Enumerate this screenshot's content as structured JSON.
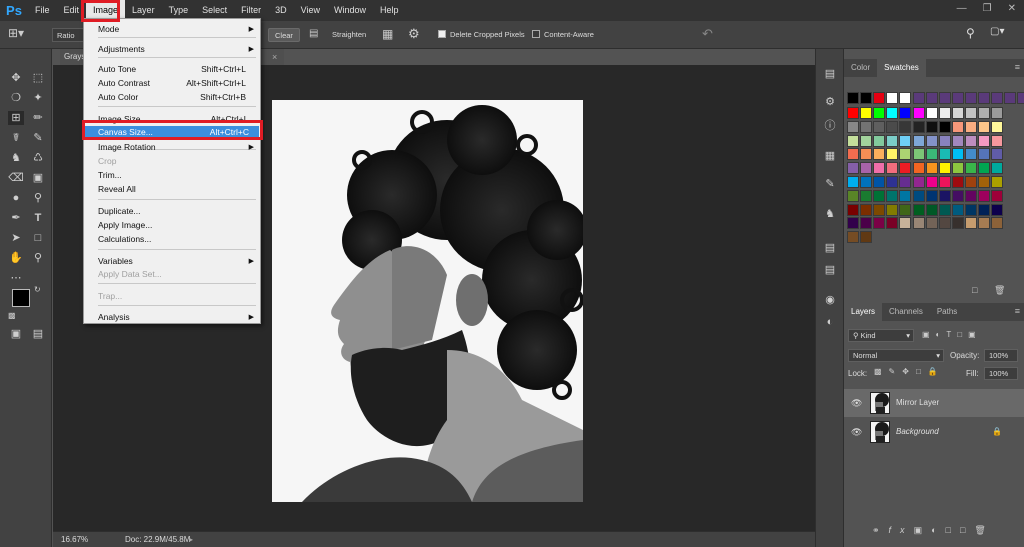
{
  "app": {
    "logo": "Ps"
  },
  "menubar": {
    "items": [
      "File",
      "Edit",
      "Image",
      "Layer",
      "Type",
      "Select",
      "Filter",
      "3D",
      "View",
      "Window",
      "Help"
    ],
    "active": "Image"
  },
  "options_bar": {
    "ratio_label": "Ratio",
    "clear_label": "Clear",
    "straighten_label": "Straighten",
    "delete_cropped_label": "Delete Cropped Pixels",
    "content_aware_label": "Content-Aware"
  },
  "document": {
    "tab_label": "Grays"
  },
  "status": {
    "zoom": "16.67%",
    "doc_size": "Doc: 22.9M/45.8M"
  },
  "image_menu": {
    "items": [
      {
        "label": "Mode",
        "shortcut": "",
        "submenu": true,
        "disabled": false
      },
      {
        "label": "Adjustments",
        "shortcut": "",
        "submenu": true,
        "disabled": false
      },
      {
        "label": "Auto Tone",
        "shortcut": "Shift+Ctrl+L",
        "submenu": false,
        "disabled": false
      },
      {
        "label": "Auto Contrast",
        "shortcut": "Alt+Shift+Ctrl+L",
        "submenu": false,
        "disabled": false
      },
      {
        "label": "Auto Color",
        "shortcut": "Shift+Ctrl+B",
        "submenu": false,
        "disabled": false
      },
      {
        "label": "Image Size...",
        "shortcut": "Alt+Ctrl+I",
        "submenu": false,
        "disabled": false
      },
      {
        "label": "Canvas Size...",
        "shortcut": "Alt+Ctrl+C",
        "submenu": false,
        "disabled": false,
        "highlighted": true
      },
      {
        "label": "Image Rotation",
        "shortcut": "",
        "submenu": true,
        "disabled": false
      },
      {
        "label": "Crop",
        "shortcut": "",
        "submenu": false,
        "disabled": true
      },
      {
        "label": "Trim...",
        "shortcut": "",
        "submenu": false,
        "disabled": false
      },
      {
        "label": "Reveal All",
        "shortcut": "",
        "submenu": false,
        "disabled": false
      },
      {
        "label": "Duplicate...",
        "shortcut": "",
        "submenu": false,
        "disabled": false
      },
      {
        "label": "Apply Image...",
        "shortcut": "",
        "submenu": false,
        "disabled": false
      },
      {
        "label": "Calculations...",
        "shortcut": "",
        "submenu": false,
        "disabled": false
      },
      {
        "label": "Variables",
        "shortcut": "",
        "submenu": true,
        "disabled": false
      },
      {
        "label": "Apply Data Set...",
        "shortcut": "",
        "submenu": false,
        "disabled": true
      },
      {
        "label": "Trap...",
        "shortcut": "",
        "submenu": false,
        "disabled": true
      },
      {
        "label": "Analysis",
        "shortcut": "",
        "submenu": true,
        "disabled": false
      }
    ]
  },
  "color_panel": {
    "tabs": [
      "Color",
      "Swatches"
    ],
    "active": "Swatches"
  },
  "swatches": {
    "row0": [
      "#000000",
      "#000000",
      "#e60012",
      "#ffffff",
      "#ffffff",
      "#5a3a7a",
      "#5a3a7a",
      "#5a3a7a",
      "#5a3a7a",
      "#5a3a7a",
      "#5a3a7a",
      "#5a3a7a",
      "#5a3a7a",
      "#5a3a7a"
    ],
    "grid": [
      [
        "#ff0000",
        "#ffff00",
        "#00ff00",
        "#00ffff",
        "#0000ff",
        "#ff00ff",
        "#ffffff",
        "#ebebeb",
        "#d7d7d7",
        "#c3c3c3",
        "#afafaf",
        "#9b9b9b"
      ],
      [
        "#878787",
        "#737373",
        "#5f5f5f",
        "#4b4b4b",
        "#373737",
        "#232323",
        "#0f0f0f",
        "#000000",
        "#f7977a",
        "#f9ad81",
        "#fdc68a",
        "#fff79a"
      ],
      [
        "#c4df9b",
        "#a2d39c",
        "#82ca9d",
        "#7bcdc8",
        "#6ecff6",
        "#7ea7d8",
        "#8493ca",
        "#8882be",
        "#a187be",
        "#bc8dbf",
        "#f49ac2",
        "#f6989d"
      ],
      [
        "#f26c4f",
        "#f68e55",
        "#fbaf5c",
        "#fff467",
        "#acd372",
        "#7cc576",
        "#3bb878",
        "#1abbb4",
        "#00bff3",
        "#438ccb",
        "#5574b9",
        "#605ca8"
      ],
      [
        "#855fa8",
        "#a763a8",
        "#f06ea9",
        "#f26d7d",
        "#ed1c24",
        "#f26522",
        "#f7941d",
        "#fff200",
        "#8dc63f",
        "#39b54a",
        "#00a651",
        "#00a99d"
      ],
      [
        "#00aeef",
        "#0072bc",
        "#0054a6",
        "#2e3192",
        "#662d91",
        "#92278f",
        "#ec008c",
        "#ed145b",
        "#9e0b0f",
        "#a0410d",
        "#a36209",
        "#aba000"
      ],
      [
        "#598527",
        "#1a7b30",
        "#007236",
        "#00746b",
        "#0076a3",
        "#004b80",
        "#003471",
        "#1b1464",
        "#440e62",
        "#630460",
        "#9e005d",
        "#9e0039"
      ],
      [
        "#790000",
        "#7b2e00",
        "#7d4900",
        "#827b00",
        "#406618",
        "#005e20",
        "#005826",
        "#005952",
        "#005b7f",
        "#003663",
        "#002157",
        "#0d004c"
      ],
      [
        "#32004b",
        "#4b0049",
        "#7b0046",
        "#7a0026",
        "#c7b299",
        "#998675",
        "#736357",
        "#534741",
        "#37302d",
        "#c69c6e",
        "#a67c52",
        "#8c6239"
      ],
      [
        "#754c24",
        "#603913"
      ]
    ]
  },
  "layers_panel": {
    "tabs": [
      "Layers",
      "Channels",
      "Paths"
    ],
    "active": "Layers",
    "filter_kind": "Kind",
    "blend_mode": "Normal",
    "opacity_label": "Opacity:",
    "opacity_value": "100%",
    "lock_label": "Lock:",
    "fill_label": "Fill:",
    "fill_value": "100%",
    "layers": [
      {
        "name": "Mirror Layer",
        "selected": true,
        "locked": false
      },
      {
        "name": "Background",
        "selected": false,
        "locked": true
      }
    ]
  }
}
